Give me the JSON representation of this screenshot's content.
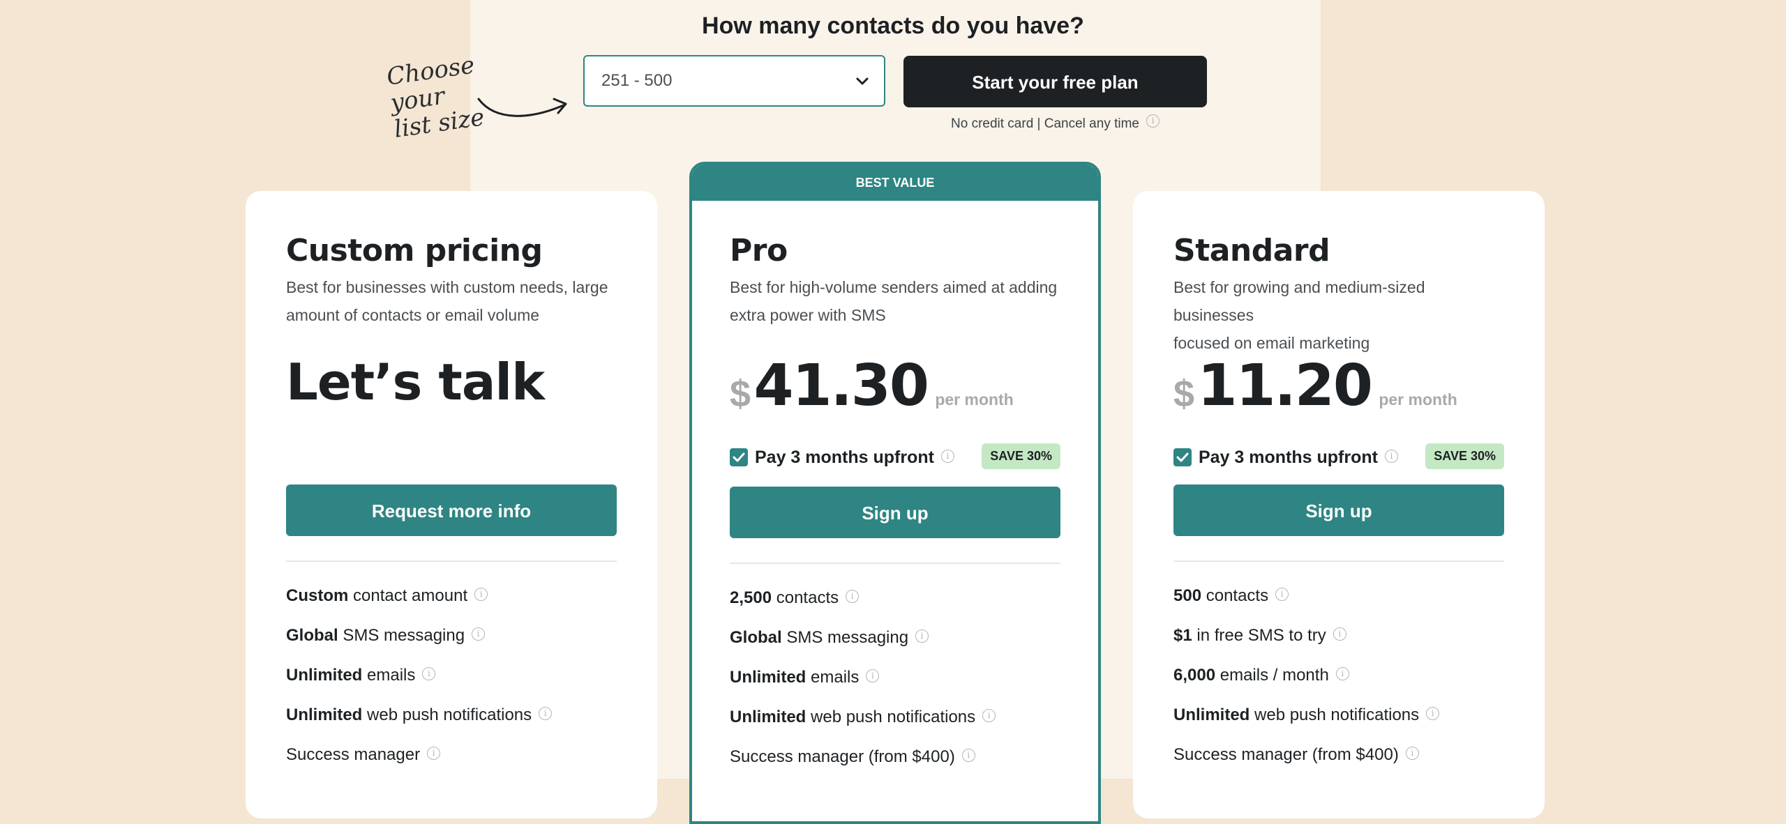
{
  "header": {
    "title": "How many contacts do you have?",
    "note_line1": "Choose your",
    "note_line2": "list size",
    "select_value": "251 - 500",
    "cta_label": "Start your free plan",
    "cta_note": "No credit card | Cancel any time"
  },
  "colors": {
    "teal": "#2e8583",
    "dark": "#1d2124",
    "bg": "#f4e6d2",
    "save_badge": "#c5e8c4"
  },
  "plans": [
    {
      "name": "Custom pricing",
      "desc_line1": "Best for businesses with custom needs, large",
      "desc_line2": "amount of contacts or email volume",
      "price_text": "Let’s talk",
      "button": "Request more info",
      "features": [
        {
          "bold": "Custom",
          "rest": " contact amount"
        },
        {
          "bold": "Global",
          "rest": " SMS messaging"
        },
        {
          "bold": "Unlimited",
          "rest": " emails"
        },
        {
          "bold": "Unlimited",
          "rest": " web push notifications"
        },
        {
          "bold": "",
          "rest": "Success manager"
        }
      ]
    },
    {
      "badge": "BEST VALUE",
      "name": "Pro",
      "desc_line1": "Best for high-volume senders aimed at adding",
      "desc_line2": "extra power with SMS",
      "currency": "$",
      "amount": "41.30",
      "per": "per month",
      "upfront": "Pay 3 months upfront",
      "save": "SAVE 30%",
      "button": "Sign up",
      "features": [
        {
          "bold": "2,500",
          "rest": " contacts"
        },
        {
          "bold": "Global",
          "rest": " SMS messaging"
        },
        {
          "bold": "Unlimited",
          "rest": " emails"
        },
        {
          "bold": "Unlimited",
          "rest": " web push notifications"
        },
        {
          "bold": "",
          "rest": "Success manager (from $400)"
        }
      ]
    },
    {
      "name": "Standard",
      "desc_line1": "Best for growing and medium-sized businesses",
      "desc_line2": "focused on email marketing",
      "currency": "$",
      "amount": "11.20",
      "per": "per month",
      "upfront": "Pay 3 months upfront",
      "save": "SAVE 30%",
      "button": "Sign up",
      "features": [
        {
          "bold": "500",
          "rest": " contacts"
        },
        {
          "bold": "$1",
          "rest": " in free SMS to try"
        },
        {
          "bold": "6,000",
          "rest": " emails / month"
        },
        {
          "bold": "Unlimited",
          "rest": " web push notifications"
        },
        {
          "bold": "",
          "rest": "Success manager (from $400)"
        }
      ]
    }
  ]
}
